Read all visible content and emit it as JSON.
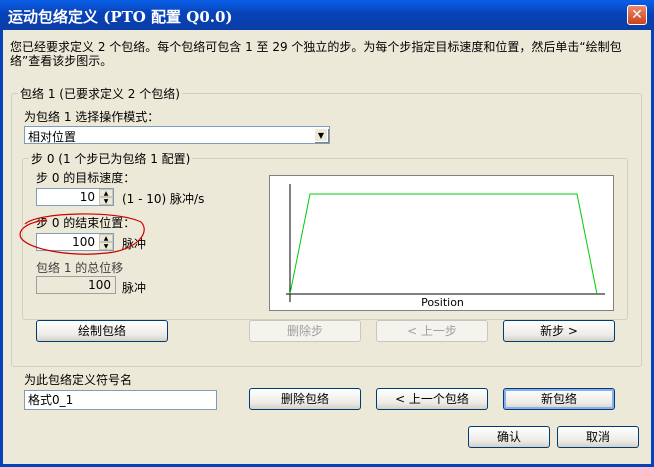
{
  "window": {
    "title": "运动包络定义 (PTO 配置 Q0.0)",
    "close_label": "✕"
  },
  "intro_text": "您已经要求定义 2 个包络。每个包络可包含 1 至 29 个独立的步。为每个步指定目标速度和位置，然后单击“绘制包络”查看该步图示。",
  "profile_group": {
    "legend": "包络 1 (已要求定义 2 个包络)",
    "mode_label": "为包络 1 选择操作模式：",
    "mode_value": "相对位置"
  },
  "step_group": {
    "legend": "步 0 (1 个步已为包络 1 配置)",
    "speed_label": "步 0 的目标速度：",
    "speed_value": "10",
    "speed_range": "(1 - 10) 脉冲/s",
    "end_pos_label": "步 0 的结束位置：",
    "end_pos_value": "100",
    "end_pos_unit": "脉冲",
    "total_label": "包络 1 的总位移",
    "total_value": "100",
    "total_unit": "脉冲",
    "graph_xlabel": "Position"
  },
  "buttons": {
    "draw_profile": "绘制包络",
    "delete_step": "删除步",
    "prev_step": "< 上一步",
    "new_step": "新步 >",
    "delete_profile": "删除包络",
    "prev_profile": "< 上一个包络",
    "new_profile": "新包络",
    "ok": "确认",
    "cancel": "取消"
  },
  "symbol": {
    "label": "为此包络定义符号名",
    "value": "格式0_1"
  },
  "colors": {
    "title_bar": "#0A5FE8",
    "profile_line": "#00CC00",
    "annotation": "#CC0000"
  }
}
